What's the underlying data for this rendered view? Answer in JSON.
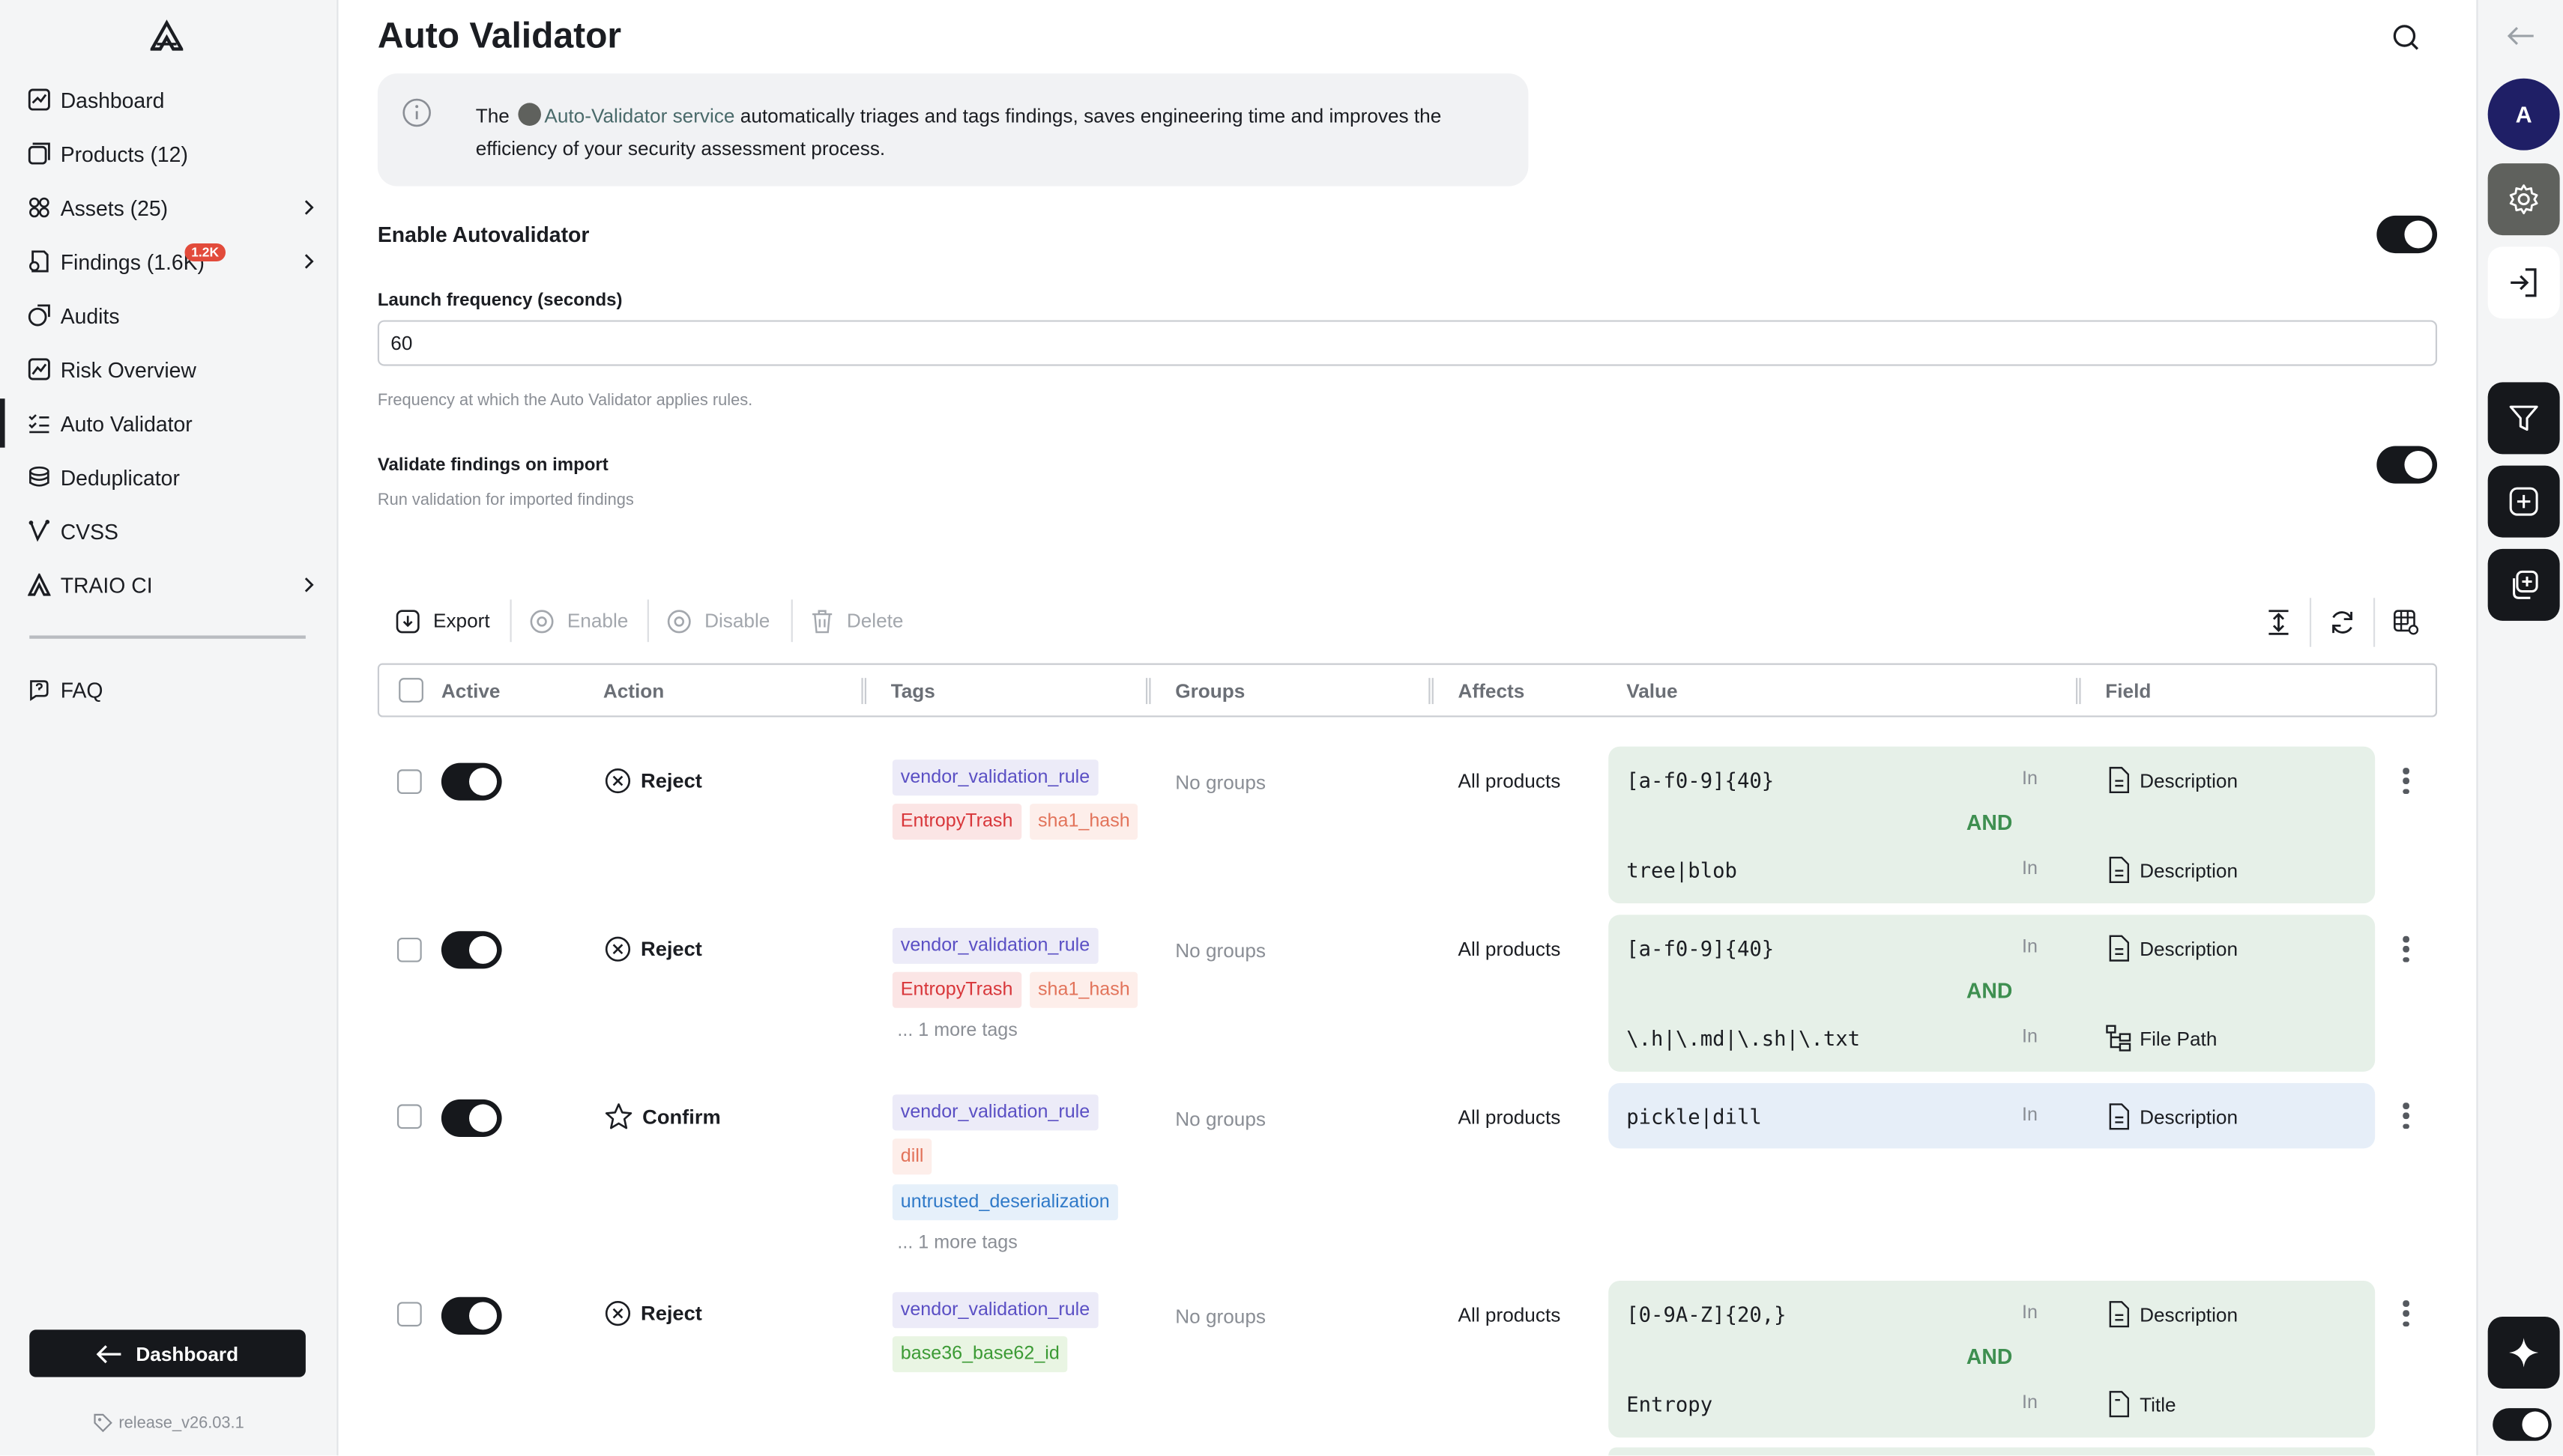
{
  "sidebar": {
    "items": [
      {
        "label": "Dashboard",
        "icon": "dashboard-icon"
      },
      {
        "label": "Products (12)",
        "icon": "products-icon"
      },
      {
        "label": "Assets (25)",
        "icon": "assets-icon"
      },
      {
        "label": "Findings (1.6K)",
        "icon": "findings-icon",
        "badge": "1.2K"
      },
      {
        "label": "Audits",
        "icon": "audits-icon"
      },
      {
        "label": "Risk Overview",
        "icon": "risk-overview-icon"
      },
      {
        "label": "Auto Validator",
        "icon": "auto-validator-icon",
        "active": true
      },
      {
        "label": "Deduplicator",
        "icon": "deduplicator-icon"
      },
      {
        "label": "CVSS",
        "icon": "cvss-icon"
      },
      {
        "label": "TRAIO CI",
        "icon": "traio-ci-icon"
      },
      {
        "label": "FAQ",
        "icon": "faq-icon"
      }
    ],
    "dashboard_button": "Dashboard",
    "release": "release_v26.03.1"
  },
  "page": {
    "title": "Auto Validator",
    "info": {
      "prefix": "The",
      "link": "Auto-Validator service",
      "rest": "automatically triages and tags findings, saves engineering time and improves the efficiency of your security assessment process."
    },
    "enable_label": "Enable Autovalidator",
    "enable_on": true,
    "frequency_label": "Launch frequency (seconds)",
    "frequency_value": "60",
    "frequency_help": "Frequency at which the Auto Validator applies rules.",
    "import_label": "Validate findings on import",
    "import_help": "Run validation for imported findings",
    "import_on": true
  },
  "toolbar": {
    "export": "Export",
    "enable": "Enable",
    "disable": "Disable",
    "delete": "Delete"
  },
  "table": {
    "headers": [
      "Active",
      "Action",
      "Tags",
      "Groups",
      "Affects",
      "Value",
      "Field"
    ],
    "rows": [
      {
        "action": "Reject",
        "tags": [
          {
            "text": "vendor_validation_rule",
            "color": "purple"
          },
          {
            "text": "EntropyTrash",
            "color": "red"
          },
          {
            "text": "sha1_hash",
            "color": "salmon"
          }
        ],
        "more": "",
        "groups": "No groups",
        "affects": "All products",
        "conditions": [
          {
            "value": "[a-f0-9]{40}",
            "op": "In",
            "field": "Description"
          },
          {
            "value": "tree|blob",
            "op": "In",
            "field": "Description"
          }
        ],
        "joiner": "AND"
      },
      {
        "action": "Reject",
        "tags": [
          {
            "text": "vendor_validation_rule",
            "color": "purple"
          },
          {
            "text": "EntropyTrash",
            "color": "red"
          },
          {
            "text": "sha1_hash",
            "color": "salmon"
          }
        ],
        "more": "... 1 more tags",
        "groups": "No groups",
        "affects": "All products",
        "conditions": [
          {
            "value": "[a-f0-9]{40}",
            "op": "In",
            "field": "Description"
          },
          {
            "value": "\\.h|\\.md|\\.sh|\\.txt",
            "op": "In",
            "field": "File Path"
          }
        ],
        "joiner": "AND"
      },
      {
        "action": "Confirm",
        "tags": [
          {
            "text": "vendor_validation_rule",
            "color": "purple"
          },
          {
            "text": "dill",
            "color": "salmon"
          },
          {
            "text": "untrusted_deserialization",
            "color": "blue"
          }
        ],
        "more": "... 1 more tags",
        "groups": "No groups",
        "affects": "All products",
        "conditions": [
          {
            "value": "pickle|dill",
            "op": "In",
            "field": "Description"
          }
        ],
        "joiner": ""
      },
      {
        "action": "Reject",
        "tags": [
          {
            "text": "vendor_validation_rule",
            "color": "purple"
          },
          {
            "text": "base36_base62_id",
            "color": "green"
          }
        ],
        "more": "",
        "groups": "No groups",
        "affects": "All products",
        "conditions": [
          {
            "value": "[0-9A-Z]{20,}",
            "op": "In",
            "field": "Description"
          },
          {
            "value": "Entropy",
            "op": "In",
            "field": "Title"
          }
        ],
        "joiner": "AND"
      }
    ]
  },
  "rail": {
    "avatar": "A"
  },
  "colors": {
    "accent_dark": "#16181c",
    "and_green": "#3e8f50",
    "value_green_bg": "#e6f0e8",
    "value_blue_bg": "#e6eef8",
    "badge_red": "#e24b3b"
  }
}
